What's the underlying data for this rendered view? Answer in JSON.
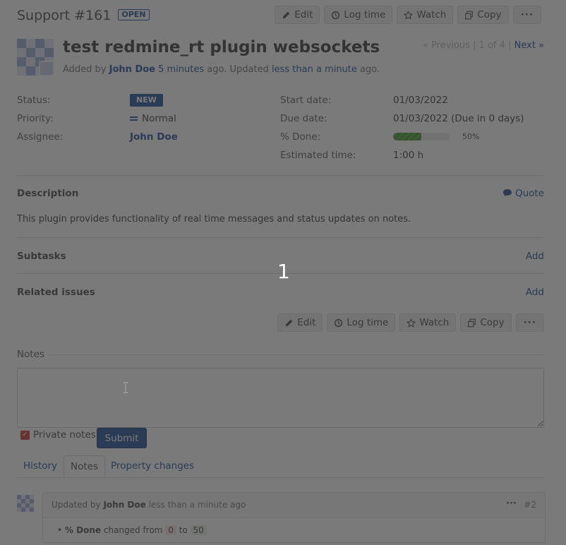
{
  "header": {
    "tracker_title": "Support #161",
    "status_badge": "OPEN",
    "toolbar": {
      "edit": "Edit",
      "log_time": "Log time",
      "watch": "Watch",
      "copy": "Copy",
      "more": "···"
    }
  },
  "issue": {
    "subject": "test redmine_rt plugin websockets",
    "added_by_prefix": "Added by",
    "author": "John Doe",
    "created_ago": "5 minutes",
    "middle": "ago. Updated",
    "updated_ago": "less than a minute",
    "suffix": "ago."
  },
  "navigation": {
    "previous": "« Previous",
    "separator1": "|",
    "position": "1 of 4",
    "separator2": "|",
    "next": "Next »"
  },
  "attributes": {
    "status_label": "Status:",
    "status_value": "NEW",
    "priority_label": "Priority:",
    "priority_value": "Normal",
    "assignee_label": "Assignee:",
    "assignee_value": "John Doe",
    "start_date_label": "Start date:",
    "start_date_value": "01/03/2022",
    "due_date_label": "Due date:",
    "due_date_value": "01/03/2022 (Due in 0 days)",
    "done_label": "% Done:",
    "done_value": "50%",
    "done_fraction": 0.5,
    "estimated_label": "Estimated time:",
    "estimated_value": "1:00 h"
  },
  "description": {
    "title": "Description",
    "quote": "Quote",
    "text": "This plugin provides functionality of real time messages and status updates on notes."
  },
  "subtasks": {
    "title": "Subtasks",
    "add": "Add"
  },
  "related": {
    "title": "Related issues",
    "add": "Add"
  },
  "notes": {
    "legend": "Notes",
    "private_label": "Private notes",
    "submit": "Submit"
  },
  "tabs": [
    "History",
    "Notes",
    "Property changes"
  ],
  "journal": {
    "updated_by": "Updated by",
    "author": "John Doe",
    "ago": "less than a minute",
    "ago_suffix": "ago",
    "more": "···",
    "number": "#2",
    "field": "% Done",
    "changed_from": "changed from",
    "old_value": "0",
    "to": "to",
    "new_value": "50"
  },
  "overlay_counter": "1",
  "colors": {
    "link": "#2a5a9f",
    "status_new": "#2a5a9f",
    "private_checkbox": "#d04437"
  }
}
